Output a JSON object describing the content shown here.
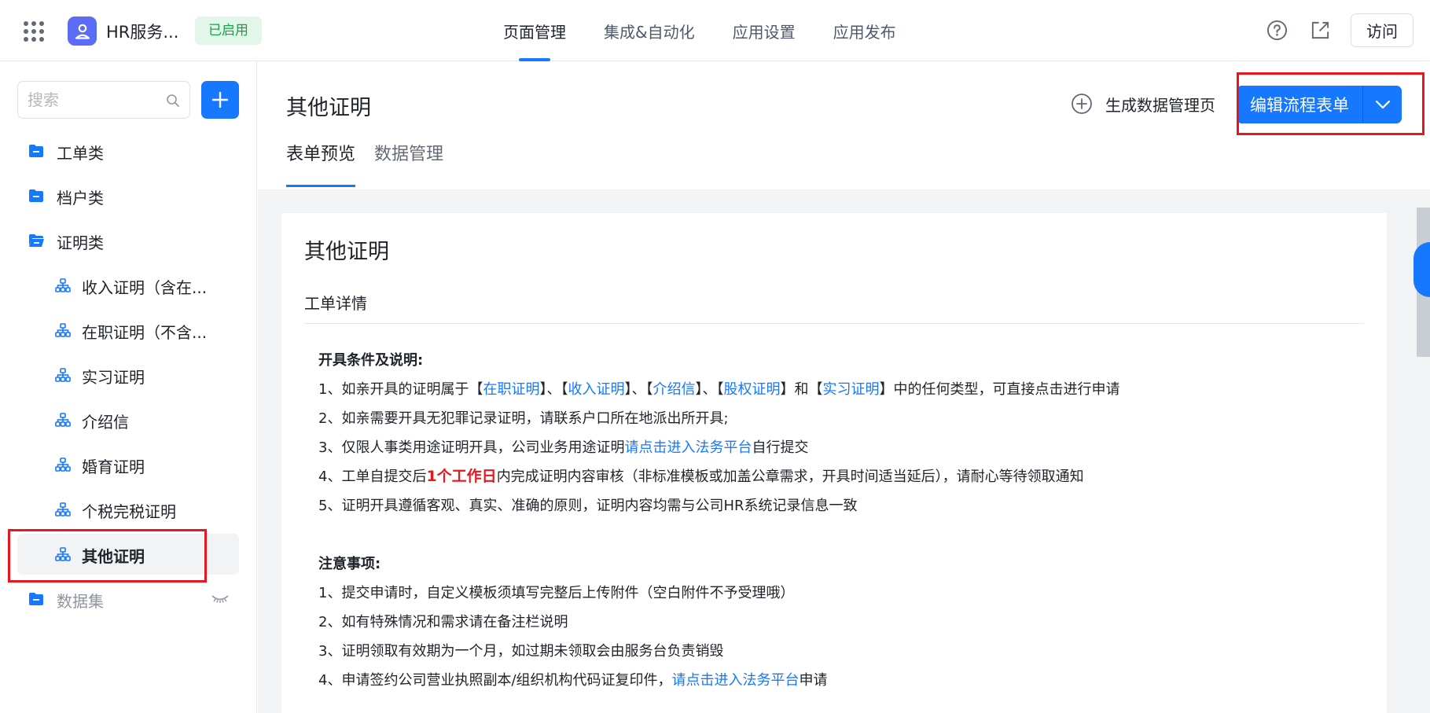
{
  "header": {
    "app_name": "HR服务...",
    "status": "已启用",
    "tabs": [
      {
        "label": "页面管理",
        "active": true
      },
      {
        "label": "集成&自动化",
        "active": false
      },
      {
        "label": "应用设置",
        "active": false
      },
      {
        "label": "应用发布",
        "active": false
      }
    ],
    "visit_label": "访问"
  },
  "sidebar": {
    "search_placeholder": "搜索",
    "items": [
      {
        "label": "工单类",
        "type": "folder"
      },
      {
        "label": "档户类",
        "type": "folder"
      },
      {
        "label": "证明类",
        "type": "folder-open"
      },
      {
        "label": "收入证明（含在...",
        "type": "child"
      },
      {
        "label": "在职证明（不含...",
        "type": "child"
      },
      {
        "label": "实习证明",
        "type": "child"
      },
      {
        "label": "介绍信",
        "type": "child"
      },
      {
        "label": "婚育证明",
        "type": "child"
      },
      {
        "label": "个税完税证明",
        "type": "child"
      },
      {
        "label": "其他证明",
        "type": "child",
        "active": true
      },
      {
        "label": "数据集",
        "type": "folder",
        "muted": true
      }
    ]
  },
  "main": {
    "title": "其他证明",
    "gen_data_label": "生成数据管理页",
    "edit_label": "编辑流程表单",
    "sub_tabs": [
      {
        "label": "表单预览",
        "active": true
      },
      {
        "label": "数据管理",
        "active": false
      }
    ]
  },
  "form": {
    "title": "其他证明",
    "section": "工单详情",
    "conditions_heading": "开具条件及说明:",
    "c1_a": "1、如亲开具的证明属于【",
    "c1_l1": "在职证明",
    "c1_b": "】、【",
    "c1_l2": "收入证明",
    "c1_c": "】、【",
    "c1_l3": "介绍信",
    "c1_d": "】、【",
    "c1_l4": "股权证明",
    "c1_e": "】和【",
    "c1_l5": "实习证明",
    "c1_f": "】中的任何类型，可直接点击进行申请",
    "c2": "2、如亲需要开具无犯罪记录证明，请联系户口所在地派出所开具;",
    "c3_a": "3、仅限人事类用途证明开具，公司业务用途证明",
    "c3_link": "请点击进入法务平台",
    "c3_b": "自行提交",
    "c4_a": "4、工单自提交后",
    "c4_red": "1个工作日",
    "c4_b": "内完成证明内容审核（非标准模板或加盖公章需求，开具时间适当延后），请耐心等待领取通知",
    "c5": "5、证明开具遵循客观、真实、准确的原则，证明内容均需与公司HR系统记录信息一致",
    "notes_heading": "注意事项:",
    "n1": "1、提交申请时，自定义模板须填写完整后上传附件（空白附件不予受理哦）",
    "n2": "2、如有特殊情况和需求请在备注栏说明",
    "n3": "3、证明领取有效期为一个月，如过期未领取会由服务台负责销毁",
    "n4_a": "4、申请签约公司营业执照副本/组织机构代码证复印件，",
    "n4_link": "请点击进入法务平台",
    "n4_b": "申请"
  },
  "colors": {
    "primary": "#1677ff",
    "highlight": "#e8161f",
    "success": "#17a34a"
  }
}
